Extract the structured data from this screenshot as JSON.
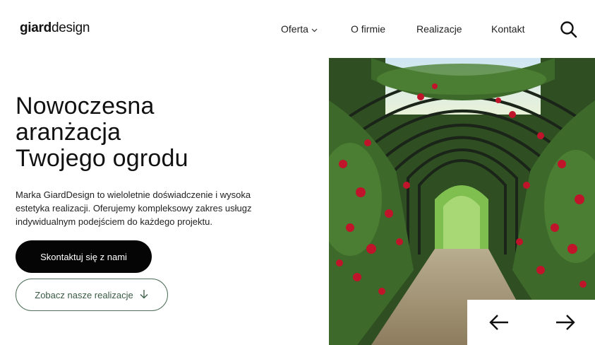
{
  "header": {
    "logo_bold": "giard",
    "logo_light": "design",
    "nav": [
      {
        "label": "Oferta",
        "icon": "chevron-down-icon"
      },
      {
        "label": "O firmie"
      },
      {
        "label": "Realizacje"
      },
      {
        "label": "Kontakt"
      }
    ],
    "search_icon": "search-icon"
  },
  "hero": {
    "title_line1": "Nowoczesna",
    "title_line2": "aranżacja",
    "title_line3": "Twojego ogrodu",
    "description": "Marka GiardDesign to wieloletnie doświadczenie i wysoka estetyka realizacji. Oferujemy kompleksowy zakres usługz indywidualnym podejściem do każdego projektu.",
    "primary_button": "Skontaktuj się z nami",
    "secondary_button": "Zobacz nasze realizacje",
    "secondary_button_icon": "arrow-down-icon"
  },
  "slider": {
    "prev_icon": "arrow-left-icon",
    "next_icon": "arrow-right-icon"
  },
  "colors": {
    "primary_button_bg": "#050505",
    "secondary_button_border": "#4f6f5a",
    "secondary_button_text": "#3a5a45",
    "foliage": "#3d6a2a",
    "roses": "#c0142a"
  }
}
